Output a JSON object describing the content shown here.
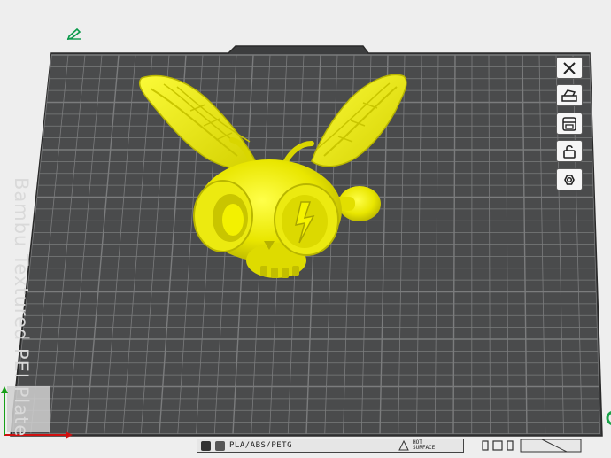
{
  "viewport": {
    "plate_label": "Bambu Textured PEI Plate",
    "model_color": "#f2f000",
    "plate_color": "#4a4b4c",
    "grid_color": "#7b7c7d",
    "background_color": "#eeeeee"
  },
  "plate_toolbar": {
    "items": [
      {
        "name": "close-plate-button",
        "icon": "close-icon"
      },
      {
        "name": "auto-orient-button",
        "icon": "orient-icon"
      },
      {
        "name": "arrange-button",
        "icon": "arrange-icon"
      },
      {
        "name": "lock-plate-button",
        "icon": "lock-icon"
      },
      {
        "name": "plate-settings-button",
        "icon": "settings-icon"
      }
    ]
  },
  "status_bar": {
    "filament_types": "PLA/ABS/PETG",
    "warning": [
      "HOT",
      "SURFACE"
    ]
  }
}
